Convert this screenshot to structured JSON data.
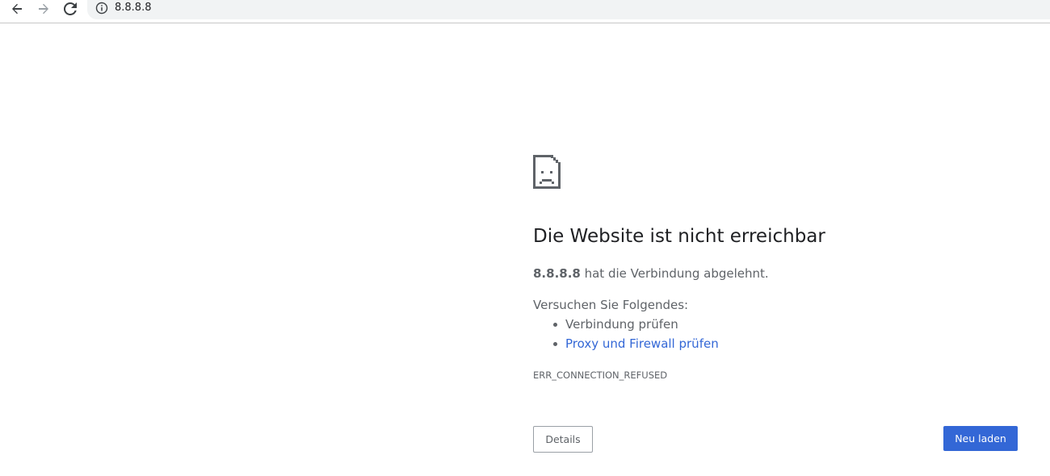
{
  "browser": {
    "back_icon": "arrow-left-icon",
    "forward_icon": "arrow-right-icon",
    "reload_icon": "reload-icon",
    "info_icon": "info-circle-icon",
    "url": "8.8.8.8"
  },
  "error_page": {
    "icon": "sad-page-icon",
    "heading": "Die Website ist nicht erreichbar",
    "summary_host": "8.8.8.8",
    "summary_text": " hat die Verbindung abgelehnt.",
    "suggestions_title": "Versuchen Sie Folgendes:",
    "suggestions": [
      {
        "label": "Verbindung prüfen",
        "is_link": false
      },
      {
        "label": "Proxy und Firewall prüfen",
        "is_link": true
      }
    ],
    "error_code": "ERR_CONNECTION_REFUSED",
    "details_button": "Details",
    "reload_button": "Neu laden"
  },
  "colors": {
    "text_primary": "#202124",
    "text_secondary": "#5f6368",
    "link": "#3367d6",
    "button_primary_bg": "#3367d6",
    "omnibox_bg": "#f1f3f4"
  }
}
